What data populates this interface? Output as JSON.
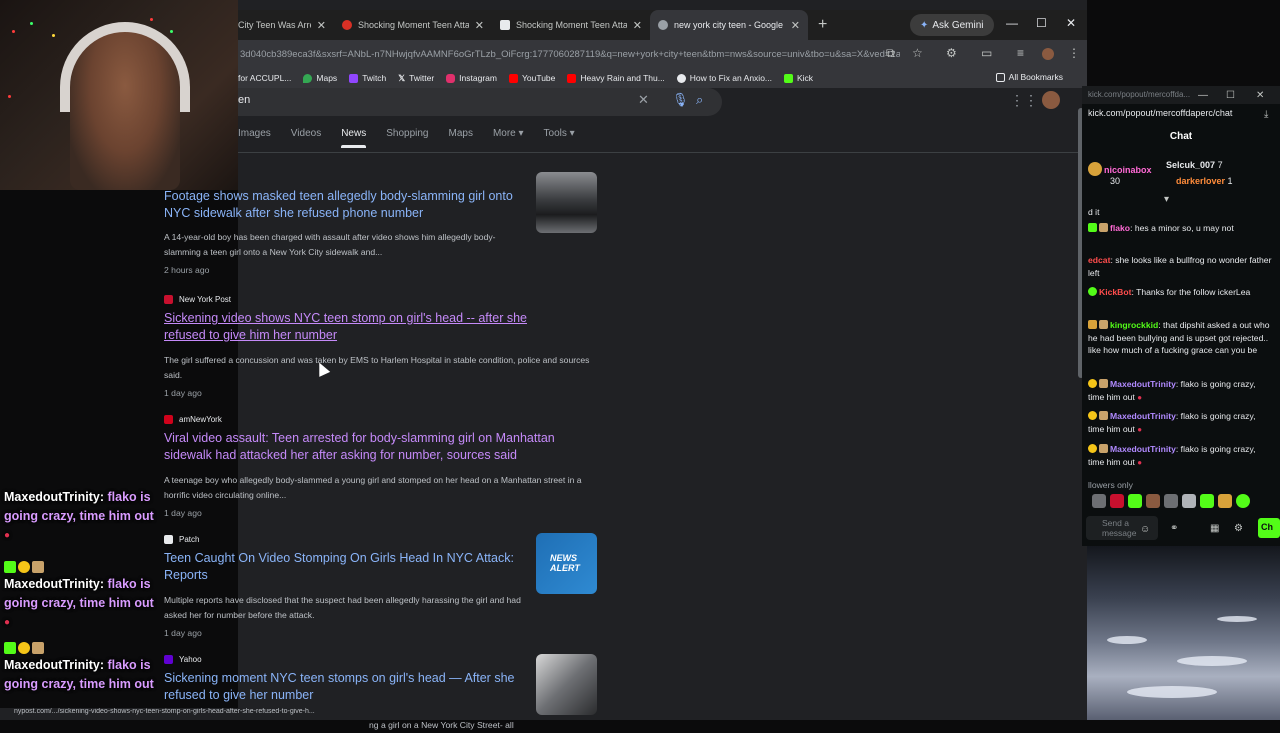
{
  "tabs": [
    {
      "label": "City Teen Was Arre",
      "active": false,
      "color": "#8ab4f8"
    },
    {
      "label": "Shocking Moment Teen Attack",
      "active": false,
      "color": "#d93025"
    },
    {
      "label": "Shocking Moment Teen Attack",
      "active": false,
      "color": "#e8eaed"
    },
    {
      "label": "new york city teen - Google Se",
      "active": true,
      "color": "#9aa0a6"
    }
  ],
  "gemini_label": "Ask Gemini",
  "url": "3d040cb389eca3f&sxsrf=ANbL-n7NHwjqfvAAMNF6oGrTLzb_OiFcrg:1777060287119&q=new+york+city+teen&tbm=nws&source=univ&tbo=u&sa=X&ved=2a...",
  "bookmarks": [
    {
      "label": "for ACCUPL...",
      "color": "#e8eaed"
    },
    {
      "label": "Maps",
      "color": "#34a853"
    },
    {
      "label": "Twitch",
      "color": "#9146ff"
    },
    {
      "label": "Twitter",
      "color": "#e8eaed"
    },
    {
      "label": "Instagram",
      "color": "#e1306c"
    },
    {
      "label": "YouTube",
      "color": "#ff0000"
    },
    {
      "label": "Heavy Rain and Thu...",
      "color": "#ff0000"
    },
    {
      "label": "How to Fix an Anxio...",
      "color": "#e8eaed"
    },
    {
      "label": "Kick",
      "color": "#53fc18"
    }
  ],
  "all_bookmarks": "All Bookmarks",
  "search_query": "en",
  "gnav": [
    "Images",
    "Videos",
    "News",
    "Shopping",
    "Maps",
    "More ▾",
    "Tools ▾"
  ],
  "results": [
    {
      "source": "",
      "title": "Footage shows masked teen allegedly body-slamming girl onto NYC sidewalk after she refused phone number",
      "snippet": "A 14-year-old boy has been charged with assault after video shows him allegedly body-slamming a teen girl onto a New York City sidewalk and...",
      "time": "2 hours ago"
    },
    {
      "source": "New York Post",
      "title": "Sickening video shows NYC teen stomp on girl's head -- after she refused to give him her number",
      "snippet": "The girl suffered a concussion and was taken by EMS to Harlem Hospital in stable condition, police and sources said.",
      "time": "1 day ago"
    },
    {
      "source": "amNewYork",
      "title": "Viral video assault: Teen arrested for body-slamming girl on Manhattan sidewalk had attacked her after asking for number, sources said",
      "snippet": "A teenage boy who allegedly body-slammed a young girl and stomped on her head on a Manhattan street in a horrific video circulating online...",
      "time": "1 day ago"
    },
    {
      "source": "Patch",
      "title": "Teen Caught On Video Stomping On Girls Head In NYC Attack: Reports",
      "snippet": "Multiple reports have disclosed that the suspect had been allegedly harassing the girl and had asked her for number before the attack.",
      "time": "1 day ago",
      "thumb_text": "NEWS ALERT"
    },
    {
      "source": "Yahoo",
      "title": "Sickening moment NYC teen stomps on girl's head — After she refused to give her number",
      "snippet": "ng a girl on a New York City Street- all",
      "time": ""
    }
  ],
  "status_url": "nypost.com/.../sickening-video-shows-nyc-teen-stomp-on-girls-head-after-she-refused-to-give-h...",
  "overlay_chat": [
    {
      "user": "MaxedoutTrinity",
      "message": "flako is going crazy, time him out"
    },
    {
      "user": "MaxedoutTrinity",
      "message": "flako is going crazy, time him out"
    },
    {
      "user": "MaxedoutTrinity",
      "message": "flako is going crazy, time him out"
    }
  ],
  "kick": {
    "title": "kick.com/popout/mercoffda...",
    "address": "kick.com/popout/mercoffdaperc/chat",
    "header": "Chat",
    "pinned": [
      {
        "user": "nicoinabox",
        "count": "30"
      },
      {
        "user": "Selcuk_007",
        "count": "7"
      },
      {
        "user": "darkerlover",
        "count": "1"
      }
    ],
    "messages": [
      {
        "user": "",
        "text": "d it",
        "color": "#e8eaed"
      },
      {
        "user": "flako",
        "text": ": hes a minor so, u may not",
        "color": "#ff6ad5"
      },
      {
        "user": "edcat",
        "text": ": she looks like a bullfrog no wonder father left",
        "color": "#ff4d4d"
      },
      {
        "user": "KickBot",
        "text": ": Thanks for the follow ickerLea",
        "color": "#ff4d4d"
      },
      {
        "user": "kingrockkid",
        "text": ": that dipshit asked a out who he had been bullying and is upset got rejected.. like how much of a fucking grace can you be",
        "color": "#53fc18"
      },
      {
        "user": "MaxedoutTrinity",
        "text": ": flako is going crazy, time him out",
        "color": "#b18aff"
      },
      {
        "user": "MaxedoutTrinity",
        "text": ": flako is going crazy, time him out",
        "color": "#b18aff"
      },
      {
        "user": "MaxedoutTrinity",
        "text": ": flako is going crazy, time him out",
        "color": "#b18aff"
      }
    ],
    "followers_only": "llowers only",
    "input_placeholder": "Send a message",
    "send_label": "Ch"
  }
}
